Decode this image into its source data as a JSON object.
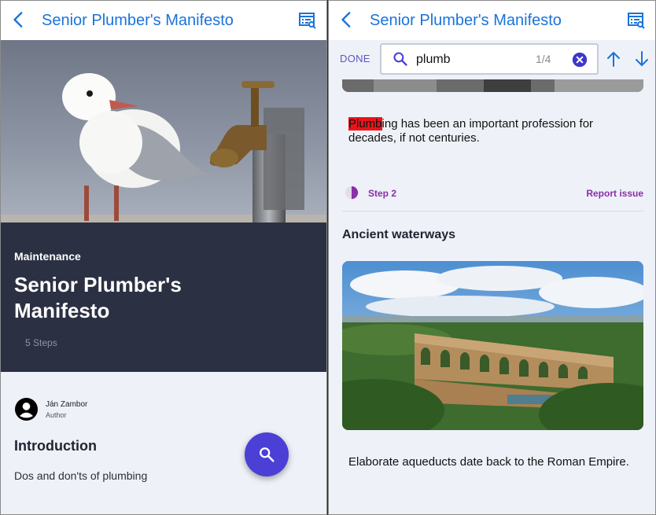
{
  "app_title": "Senior Plumber's Manifesto",
  "left": {
    "category": "Maintenance",
    "title": "Senior Plumber's Manifesto",
    "steps": "5 Steps",
    "author": {
      "name": "Ján Zambor",
      "role": "Author"
    },
    "intro": {
      "heading": "Introduction",
      "text": "Dos and don'ts of plumbing"
    }
  },
  "right": {
    "find": {
      "done_label": "DONE",
      "query": "plumb",
      "count": "1/4"
    },
    "paragraph": {
      "highlight": "Plumb",
      "rest": "ing has been an important profession for decades, if not centuries."
    },
    "step": {
      "label": "Step 2",
      "report": "Report issue"
    },
    "section": {
      "heading": "Ancient waterways",
      "caption": "Elaborate aqueducts date back to the Roman Empire."
    }
  },
  "colors": {
    "accent_blue": "#1a73d9",
    "fab": "#4b3fd6",
    "hero_dark": "#2b3142",
    "highlight": "#e8141c",
    "step_purple": "#8a2fa8"
  },
  "icons": [
    "back-arrow-icon",
    "table-of-contents-icon",
    "search-icon",
    "clear-icon",
    "arrow-up-icon",
    "arrow-down-icon",
    "avatar-icon",
    "progress-pie-icon"
  ]
}
